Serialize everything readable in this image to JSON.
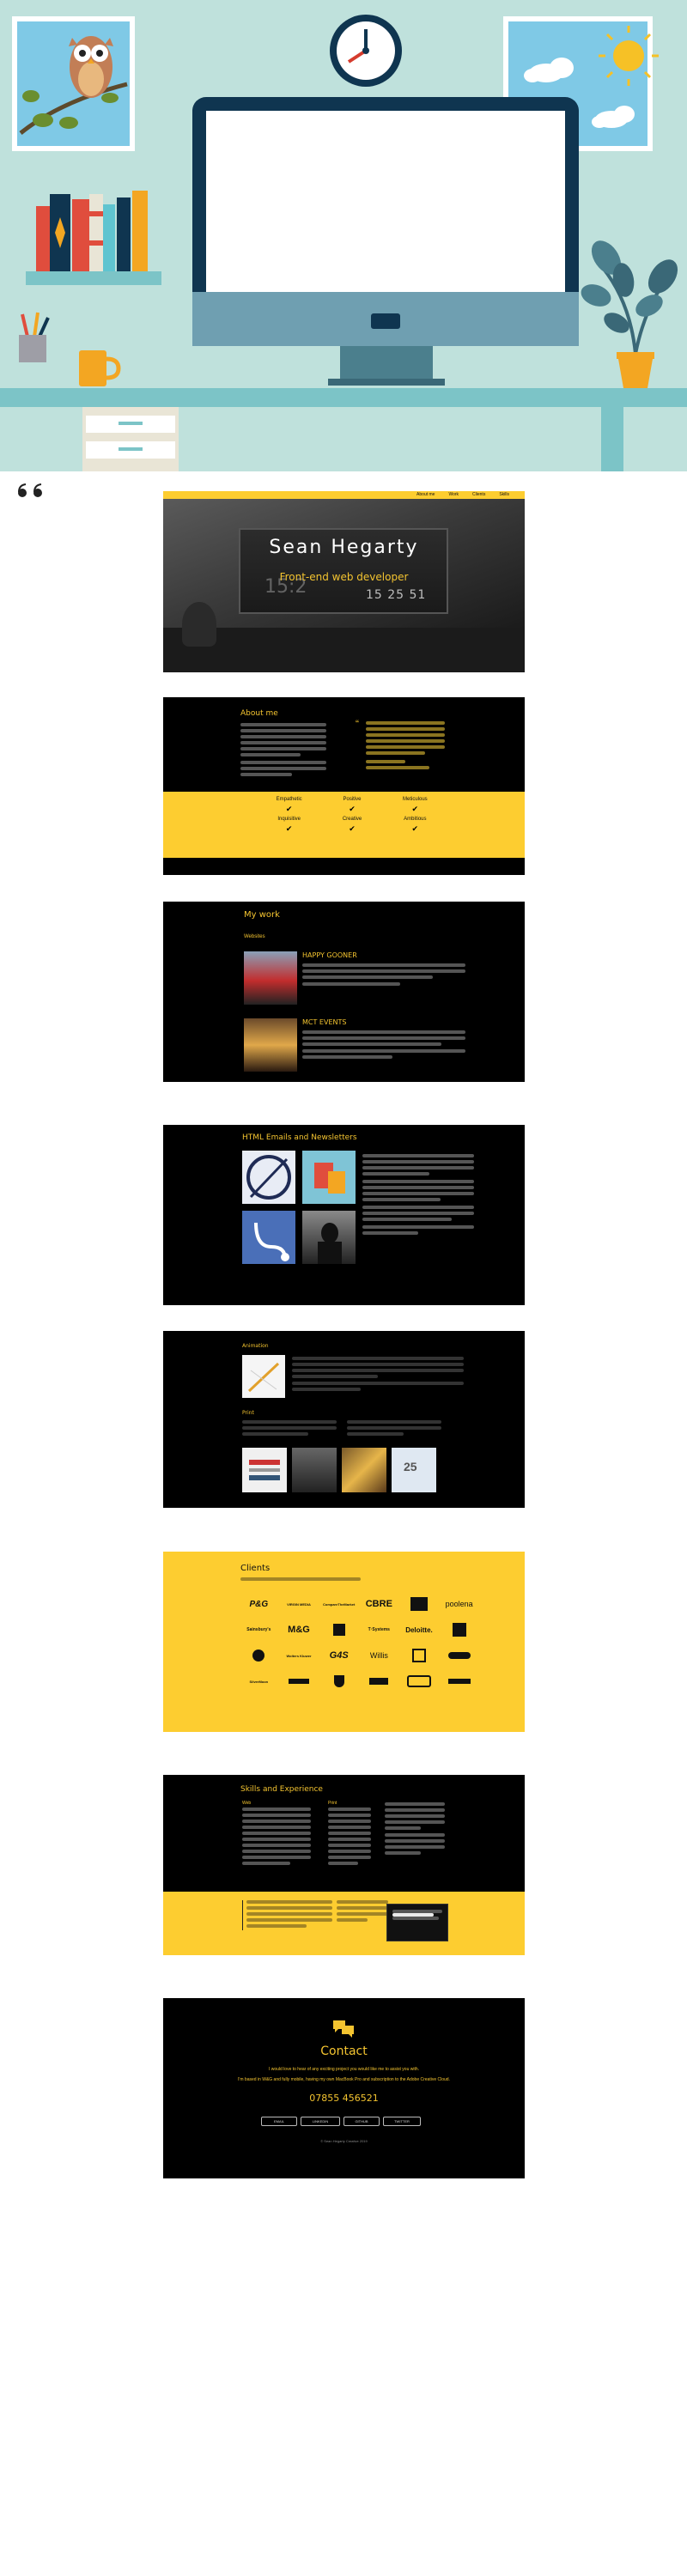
{
  "nav": {
    "items": [
      "About me",
      "Work",
      "Clients",
      "Skills"
    ]
  },
  "header": {
    "title": "Sean Hegarty",
    "subtitle": "Front-end web developer",
    "clock": "15 25 51",
    "clock_faint": "15:2"
  },
  "about": {
    "title": "About me",
    "qualities": [
      "Empathetic",
      "Positive",
      "Meticulous",
      "Inquisitive",
      "Creative",
      "Ambitious"
    ]
  },
  "work": {
    "title": "My work",
    "websites_label": "Websites",
    "project1": "HAPPY GOONER",
    "project2": "MCT EVENTS"
  },
  "html_emails": {
    "title": "HTML Emails and Newsletters"
  },
  "animation": {
    "title": "Animation",
    "print_label": "Print",
    "badge": "25"
  },
  "clients": {
    "title": "Clients",
    "logos_row1": [
      "P&G",
      "VIRGIN MEDIA",
      "CompareTheMarket",
      "CBRE",
      "",
      "poolena"
    ],
    "logos_row2": [
      "Sainsbury's",
      "M&G",
      "",
      "T·Systems",
      "Deloitte.",
      ""
    ],
    "logos_row3": [
      "",
      "Wolters Kluwer",
      "G4S",
      "Willis",
      "",
      ""
    ],
    "logos_row4": [
      "SilverMoon",
      "",
      "",
      "",
      "",
      ""
    ]
  },
  "skills": {
    "title": "Skills and Experience",
    "col1": "Web",
    "col2": "Print"
  },
  "contact": {
    "title": "Contact",
    "line1": "I would love to hear of any exciting project you would like me to assist you with.",
    "line2": "I'm based in W&G and fully mobile, having my own MacBook Pro and subscription to the Adobe Creative Cloud.",
    "phone": "07855 456521",
    "buttons": [
      "EMAIL",
      "LINKEDIN",
      "GITHUB",
      "TWITTER"
    ],
    "footer": "© Sean Hegarty Creative 2019"
  },
  "colors": {
    "accent": "#fdcd30",
    "dark": "#000000",
    "hero_bg": "#bfe1dc",
    "screen_frame": "#0f3550"
  },
  "icons": [
    "owl-icon",
    "clock-icon",
    "sun-icon",
    "cloud-icon",
    "books-icon",
    "pencil-cup-icon",
    "mug-icon",
    "plant-icon",
    "quote-mark-icon",
    "speech-bubbles-icon",
    "checkmark-icon"
  ]
}
